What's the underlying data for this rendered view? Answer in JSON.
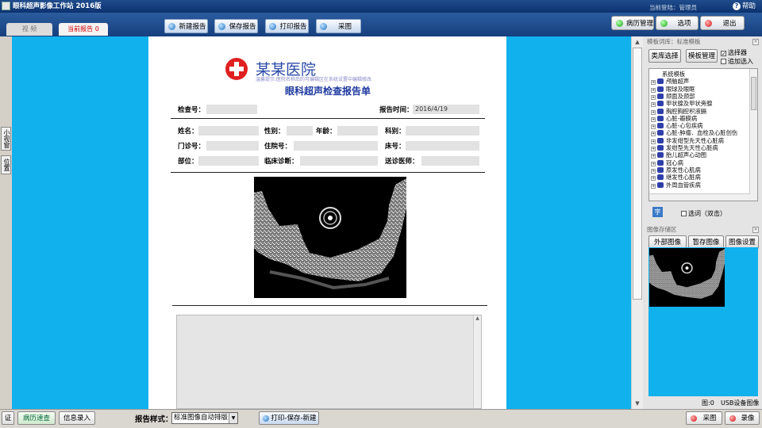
{
  "window": {
    "title": "眼科超声影像工作站 2016版",
    "help": "帮助",
    "current_user": "当前登陆：管理员"
  },
  "tabs": [
    {
      "label": "视 频"
    },
    {
      "label": "当前报告 0"
    }
  ],
  "toolbar": {
    "new_report": "新建报告",
    "save_report": "保存报告",
    "print_report": "打印报告",
    "capture": "采图"
  },
  "top_right": {
    "records": "病历管理",
    "options": "选项",
    "exit": "退出"
  },
  "left_tabs": {
    "small_window": "小视窗",
    "position": "位置"
  },
  "report": {
    "hospital": "某某医院",
    "hospital_sub": "温馨提示:医院名称后的可编辑区在系统设置中编辑修改",
    "title": "眼科超声检查报告单",
    "labels": {
      "exam_no": "检查号：",
      "report_time": "报告时间：",
      "name": "姓名：",
      "gender": "性别：",
      "age": "年龄：",
      "dept": "科别：",
      "outpatient": "门诊号：",
      "inpatient": "住院号：",
      "bed": "床号：",
      "part": "部位：",
      "diagnosis": "临床诊断：",
      "doctor": "送诊医师："
    },
    "values": {
      "report_time": "2016/4/19"
    }
  },
  "template_panel": {
    "title": "模板词库：标准模板",
    "category_button": "类库选择",
    "manage_button": "模板管理",
    "selector_label": "选择器",
    "append_label": "追加选入",
    "items": [
      "系统模板",
      "颅脑超声",
      "眼球及眼眶",
      "颌面及颈部",
      "甲状腺及甲状旁腺",
      "胸腔胸腔积液膈",
      "心脏-瓣膜病",
      "心脏-心包疾病",
      "心脏-肿瘤、血栓及心脏创伤",
      "非发绀型先天性心脏病",
      "发绀型先天性心脏病",
      "胎儿超声心动图",
      "冠心病",
      "原发性心肌病",
      "继发性心脏病",
      "外周血管疾病"
    ],
    "zi_label": "字",
    "select_dblclick": "选词（双击）"
  },
  "image_panel": {
    "title": "图像存储区",
    "external_button": "外部图像",
    "hold_button": "暂存图像",
    "settings_button": "图像设置",
    "count": "图:0",
    "device": "USB设备图像"
  },
  "bottom": {
    "cert": "证",
    "records_quick": "病历速查",
    "info_entry": "信息录入",
    "style_label": "报告样式：",
    "style_value": "标准图像自动排版",
    "print_save_new": "打印-保存-新建",
    "capture": "采图",
    "record": "录像"
  }
}
